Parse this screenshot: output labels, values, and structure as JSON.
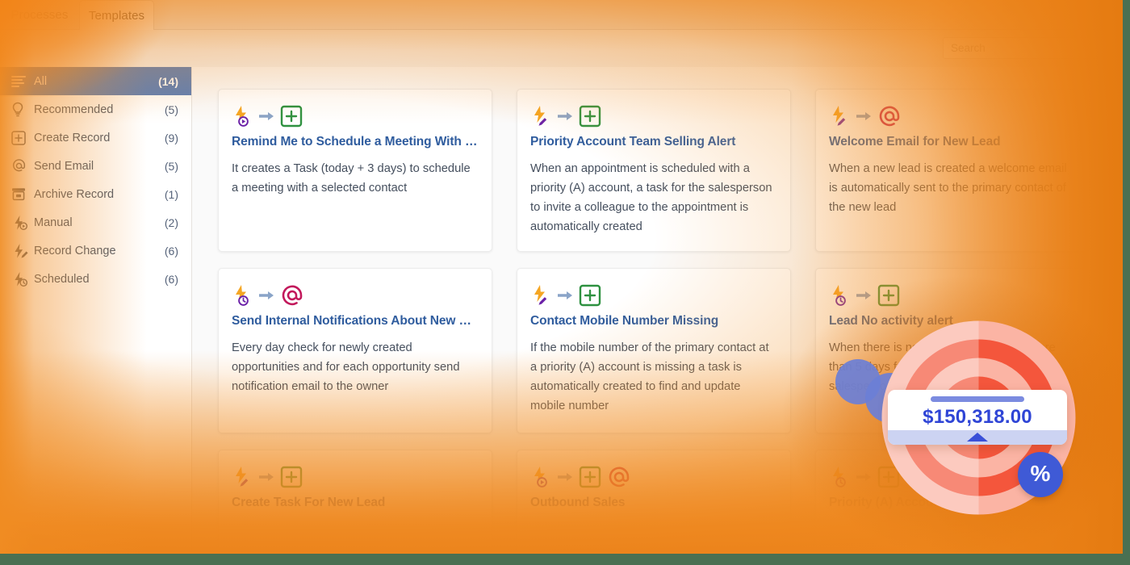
{
  "window": {
    "accent_orange": "#ee8620",
    "border_green": "#4a7052",
    "title_blue": "#2f5c9e"
  },
  "tabs": [
    {
      "label": "Processes",
      "active": false,
      "name": "tab-processes"
    },
    {
      "label": "Templates",
      "active": true,
      "name": "tab-templates"
    }
  ],
  "search": {
    "placeholder": "Search",
    "value": ""
  },
  "sidebar": {
    "items": [
      {
        "label": "All",
        "count": "(14)",
        "icon": "list-icon",
        "selected": true
      },
      {
        "label": "Recommended",
        "count": "(5)",
        "icon": "lightbulb-icon",
        "selected": false
      },
      {
        "label": "Create Record",
        "count": "(9)",
        "icon": "plus-box-icon",
        "selected": false
      },
      {
        "label": "Send Email",
        "count": "(5)",
        "icon": "at-icon",
        "selected": false
      },
      {
        "label": "Archive Record",
        "count": "(1)",
        "icon": "archive-box-icon",
        "selected": false
      },
      {
        "label": "Manual",
        "count": "(2)",
        "icon": "bolt-play-icon",
        "selected": false
      },
      {
        "label": "Record Change",
        "count": "(6)",
        "icon": "bolt-pencil-icon",
        "selected": false
      },
      {
        "label": "Scheduled",
        "count": "(6)",
        "icon": "bolt-clock-icon",
        "selected": false
      }
    ]
  },
  "templates": [
    {
      "title": "Remind Me to Schedule a Meeting With C…",
      "description": "It creates a Task (today + 3 days) to schedule a meeting with a selected contact",
      "trigger_icon": "bolt-play-icon",
      "action_icons": [
        "plus-box-icon"
      ],
      "row": 1
    },
    {
      "title": "Priority Account Team Selling Alert",
      "description": "When an appointment is scheduled with a priority (A) account, a task for the salesperson to invite a colleague to the appointment is automatically created",
      "trigger_icon": "bolt-pencil-icon",
      "action_icons": [
        "plus-box-icon"
      ],
      "row": 1
    },
    {
      "title": "Welcome Email for New Lead",
      "description": "When a new lead is created a welcome email is automatically sent to the primary contact of the new lead",
      "trigger_icon": "bolt-pencil-icon",
      "action_icons": [
        "at-icon"
      ],
      "row": 1
    },
    {
      "title": "Send Internal Notifications About New O…",
      "description": "Every day check for newly created opportunities and for each opportunity send notification email to the owner",
      "trigger_icon": "bolt-clock-icon",
      "action_icons": [
        "at-icon"
      ],
      "row": 2
    },
    {
      "title": "Contact Mobile Number Missing",
      "description": "If the mobile number of the primary contact at a priority (A) account is missing a task is automatically created to find and update mobile number",
      "trigger_icon": "bolt-pencil-icon",
      "action_icons": [
        "plus-box-icon"
      ],
      "row": 2
    },
    {
      "title": "Lead No activity alert",
      "description": "When there is no activity recorded for more than 5 days from lead creation a task for the salesperson is created",
      "trigger_icon": "bolt-clock-icon",
      "action_icons": [
        "plus-box-icon"
      ],
      "row": 2
    },
    {
      "title": "Create Task For New Lead",
      "description": "",
      "trigger_icon": "bolt-pencil-icon",
      "action_icons": [
        "plus-box-icon"
      ],
      "row": 3
    },
    {
      "title": "Outbound Sales",
      "description": "",
      "trigger_icon": "bolt-play-icon",
      "action_icons": [
        "plus-box-icon",
        "at-icon"
      ],
      "row": 3
    },
    {
      "title": "Priority (A) Account…",
      "description": "",
      "trigger_icon": "bolt-clock-icon",
      "action_icons": [
        "plus-box-icon"
      ],
      "row": 3
    }
  ],
  "overlay_graphic": {
    "price_value": "$150,318.00",
    "percent_symbol": "%",
    "target_color": "#f4563c",
    "target_color_light": "#fbb4a4",
    "badge_color": "#3f5ad6",
    "value_color": "#2f45d6"
  }
}
